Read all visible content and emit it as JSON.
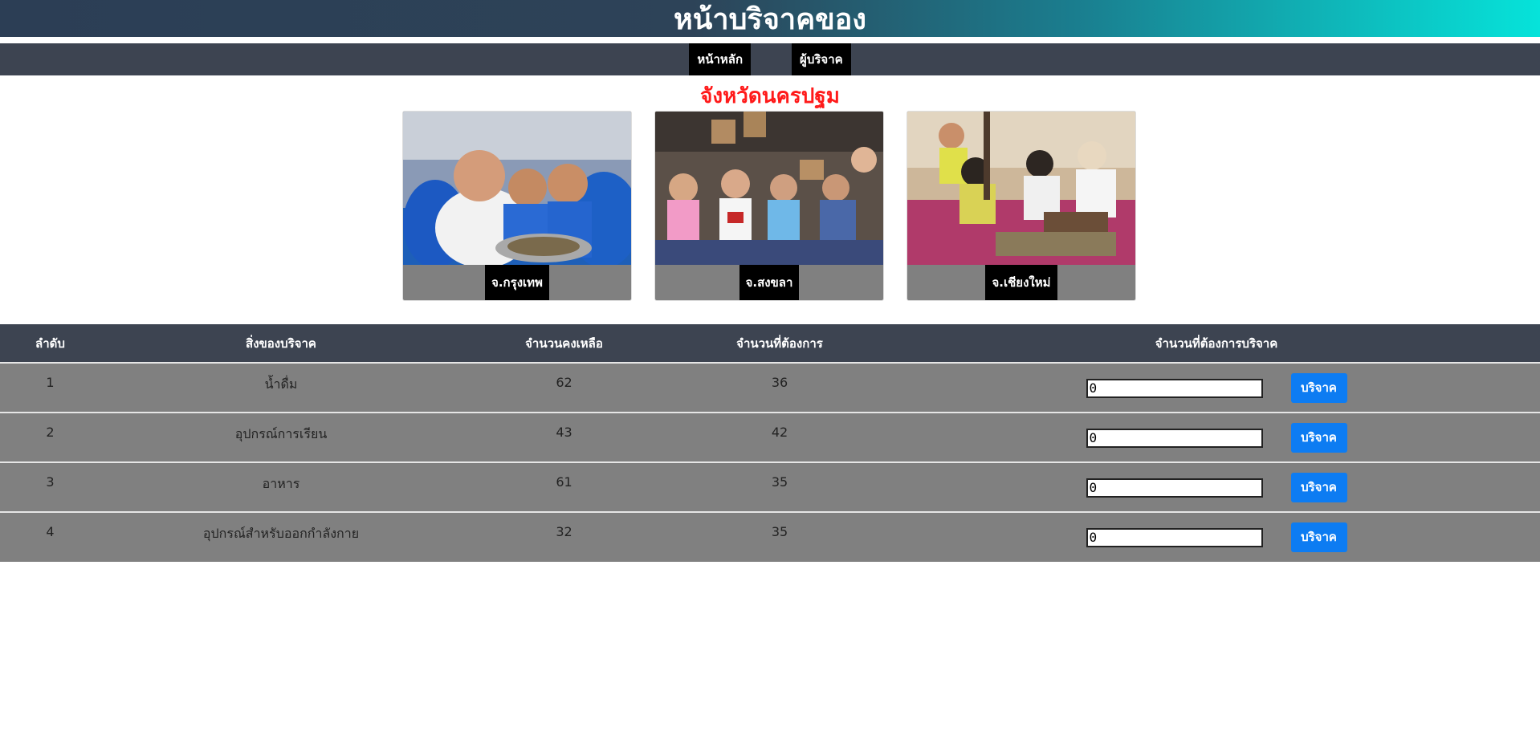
{
  "header": {
    "title": "หน้าบริจาคของ"
  },
  "nav": {
    "items": [
      {
        "label": "หน้าหลัก"
      },
      {
        "label": "ผู้บริจาค"
      }
    ]
  },
  "section": {
    "title": "จังหวัดนครปฐม"
  },
  "cards": [
    {
      "caption": "จ.กรุงเทพ"
    },
    {
      "caption": "จ.สงขลา"
    },
    {
      "caption": "จ.เชียงใหม่"
    }
  ],
  "table": {
    "headers": [
      "ลำดับ",
      "สิ่งของบริจาค",
      "จำนวนคงเหลือ",
      "จำนวนที่ต้องการ",
      "จำนวนที่ต้องการบริจาค"
    ],
    "button_label": "บริจาค",
    "rows": [
      {
        "no": "1",
        "item": "น้ำดื่ม",
        "remaining": "62",
        "needed": "36",
        "input_value": "0"
      },
      {
        "no": "2",
        "item": "อุปกรณ์การเรียน",
        "remaining": "43",
        "needed": "42",
        "input_value": "0"
      },
      {
        "no": "3",
        "item": "อาหาร",
        "remaining": "61",
        "needed": "35",
        "input_value": "0"
      },
      {
        "no": "4",
        "item": "อุปกรณ์สำหรับออกกำลังกาย",
        "remaining": "32",
        "needed": "35",
        "input_value": "0"
      }
    ]
  }
}
